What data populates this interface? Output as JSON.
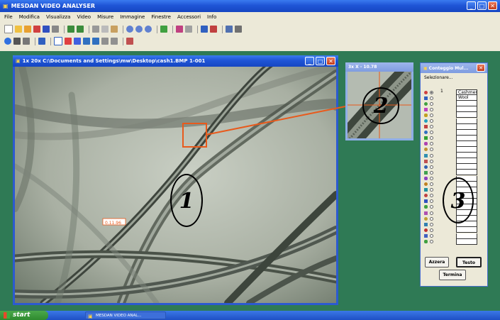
{
  "app": {
    "title": "MESDAN VIDEO ANALYSER",
    "menu": [
      "File",
      "Modifica",
      "Visualizza",
      "Video",
      "Misure",
      "Immagine",
      "Finestre",
      "Accessori",
      "Info"
    ]
  },
  "image_window": {
    "title": "1x 20x   C:\\Documents and Settings\\mw\\Desktop\\cash1.BMP 1-001",
    "measure_label": "0.11.96"
  },
  "zoom_window": {
    "title": "3x  X - 10.78"
  },
  "counter_window": {
    "title": "Conteggio Mul...",
    "subtitle": "Selezionare...",
    "selected_index": "1",
    "categories": [
      "Cashmere",
      "Wool"
    ],
    "buttons": {
      "reset": "Azzera",
      "text": "Testo",
      "finish": "Termina"
    }
  },
  "annotations": {
    "one": "1",
    "two": "2",
    "three": "3"
  },
  "taskbar": {
    "start": "start",
    "task": "MESDAN VIDEO ANAL..."
  },
  "colors": {
    "desktop": "#2f7a55",
    "highlight": "#e85a1c",
    "titlebar": "#1f55d6"
  }
}
